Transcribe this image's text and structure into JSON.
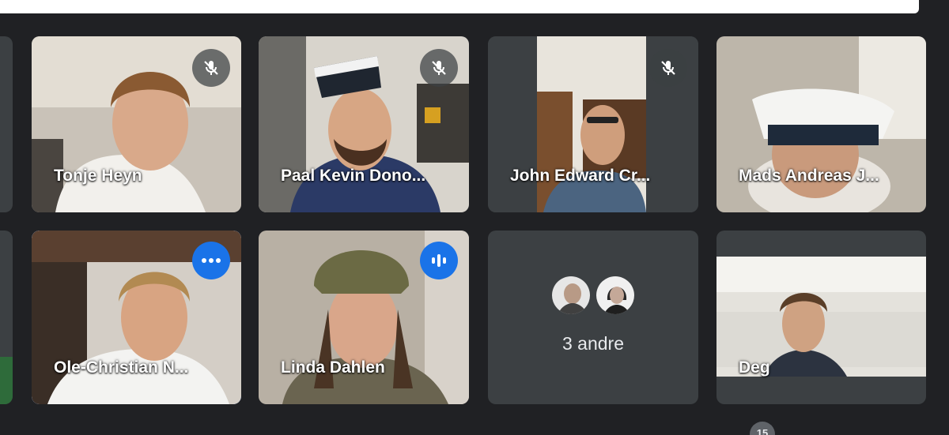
{
  "participants": [
    {
      "name": "Tonje Heyn",
      "status": "muted"
    },
    {
      "name": "Paal Kevin Dono...",
      "status": "muted"
    },
    {
      "name": "John Edward Cr...",
      "status": "muted"
    },
    {
      "name": "Mads Andreas J...",
      "status": ""
    },
    {
      "name": "Ole-Christian N...",
      "status": "more-options"
    },
    {
      "name": "Linda Dahlen",
      "status": "speaking"
    },
    {
      "name": "Deg",
      "status": ""
    }
  ],
  "others": {
    "label": "3 andre"
  },
  "participant_count": "15",
  "colors": {
    "background": "#202124",
    "tile": "#3c4043",
    "accent": "#1a73e8",
    "active_border": "#8ab4f8"
  }
}
